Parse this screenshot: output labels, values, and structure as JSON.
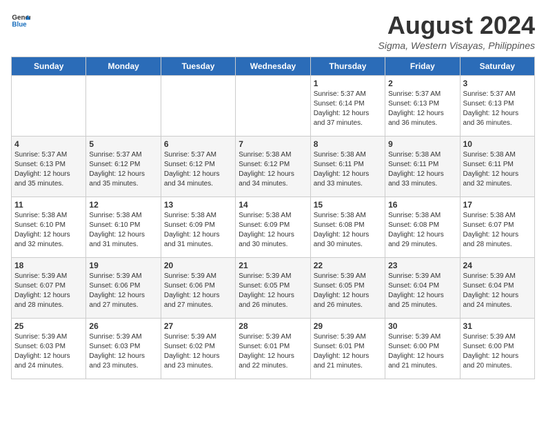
{
  "header": {
    "logo_general": "General",
    "logo_blue": "Blue",
    "month_year": "August 2024",
    "location": "Sigma, Western Visayas, Philippines"
  },
  "days_of_week": [
    "Sunday",
    "Monday",
    "Tuesday",
    "Wednesday",
    "Thursday",
    "Friday",
    "Saturday"
  ],
  "weeks": [
    [
      {
        "day": "",
        "empty": true
      },
      {
        "day": "",
        "empty": true
      },
      {
        "day": "",
        "empty": true
      },
      {
        "day": "",
        "empty": true
      },
      {
        "day": "1",
        "sunrise": "5:37 AM",
        "sunset": "6:14 PM",
        "daylight": "12 hours and 37 minutes."
      },
      {
        "day": "2",
        "sunrise": "5:37 AM",
        "sunset": "6:13 PM",
        "daylight": "12 hours and 36 minutes."
      },
      {
        "day": "3",
        "sunrise": "5:37 AM",
        "sunset": "6:13 PM",
        "daylight": "12 hours and 36 minutes."
      }
    ],
    [
      {
        "day": "4",
        "sunrise": "5:37 AM",
        "sunset": "6:13 PM",
        "daylight": "12 hours and 35 minutes."
      },
      {
        "day": "5",
        "sunrise": "5:37 AM",
        "sunset": "6:12 PM",
        "daylight": "12 hours and 35 minutes."
      },
      {
        "day": "6",
        "sunrise": "5:37 AM",
        "sunset": "6:12 PM",
        "daylight": "12 hours and 34 minutes."
      },
      {
        "day": "7",
        "sunrise": "5:38 AM",
        "sunset": "6:12 PM",
        "daylight": "12 hours and 34 minutes."
      },
      {
        "day": "8",
        "sunrise": "5:38 AM",
        "sunset": "6:11 PM",
        "daylight": "12 hours and 33 minutes."
      },
      {
        "day": "9",
        "sunrise": "5:38 AM",
        "sunset": "6:11 PM",
        "daylight": "12 hours and 33 minutes."
      },
      {
        "day": "10",
        "sunrise": "5:38 AM",
        "sunset": "6:11 PM",
        "daylight": "12 hours and 32 minutes."
      }
    ],
    [
      {
        "day": "11",
        "sunrise": "5:38 AM",
        "sunset": "6:10 PM",
        "daylight": "12 hours and 32 minutes."
      },
      {
        "day": "12",
        "sunrise": "5:38 AM",
        "sunset": "6:10 PM",
        "daylight": "12 hours and 31 minutes."
      },
      {
        "day": "13",
        "sunrise": "5:38 AM",
        "sunset": "6:09 PM",
        "daylight": "12 hours and 31 minutes."
      },
      {
        "day": "14",
        "sunrise": "5:38 AM",
        "sunset": "6:09 PM",
        "daylight": "12 hours and 30 minutes."
      },
      {
        "day": "15",
        "sunrise": "5:38 AM",
        "sunset": "6:08 PM",
        "daylight": "12 hours and 30 minutes."
      },
      {
        "day": "16",
        "sunrise": "5:38 AM",
        "sunset": "6:08 PM",
        "daylight": "12 hours and 29 minutes."
      },
      {
        "day": "17",
        "sunrise": "5:38 AM",
        "sunset": "6:07 PM",
        "daylight": "12 hours and 28 minutes."
      }
    ],
    [
      {
        "day": "18",
        "sunrise": "5:39 AM",
        "sunset": "6:07 PM",
        "daylight": "12 hours and 28 minutes."
      },
      {
        "day": "19",
        "sunrise": "5:39 AM",
        "sunset": "6:06 PM",
        "daylight": "12 hours and 27 minutes."
      },
      {
        "day": "20",
        "sunrise": "5:39 AM",
        "sunset": "6:06 PM",
        "daylight": "12 hours and 27 minutes."
      },
      {
        "day": "21",
        "sunrise": "5:39 AM",
        "sunset": "6:05 PM",
        "daylight": "12 hours and 26 minutes."
      },
      {
        "day": "22",
        "sunrise": "5:39 AM",
        "sunset": "6:05 PM",
        "daylight": "12 hours and 26 minutes."
      },
      {
        "day": "23",
        "sunrise": "5:39 AM",
        "sunset": "6:04 PM",
        "daylight": "12 hours and 25 minutes."
      },
      {
        "day": "24",
        "sunrise": "5:39 AM",
        "sunset": "6:04 PM",
        "daylight": "12 hours and 24 minutes."
      }
    ],
    [
      {
        "day": "25",
        "sunrise": "5:39 AM",
        "sunset": "6:03 PM",
        "daylight": "12 hours and 24 minutes."
      },
      {
        "day": "26",
        "sunrise": "5:39 AM",
        "sunset": "6:03 PM",
        "daylight": "12 hours and 23 minutes."
      },
      {
        "day": "27",
        "sunrise": "5:39 AM",
        "sunset": "6:02 PM",
        "daylight": "12 hours and 23 minutes."
      },
      {
        "day": "28",
        "sunrise": "5:39 AM",
        "sunset": "6:01 PM",
        "daylight": "12 hours and 22 minutes."
      },
      {
        "day": "29",
        "sunrise": "5:39 AM",
        "sunset": "6:01 PM",
        "daylight": "12 hours and 21 minutes."
      },
      {
        "day": "30",
        "sunrise": "5:39 AM",
        "sunset": "6:00 PM",
        "daylight": "12 hours and 21 minutes."
      },
      {
        "day": "31",
        "sunrise": "5:39 AM",
        "sunset": "6:00 PM",
        "daylight": "12 hours and 20 minutes."
      }
    ]
  ],
  "labels": {
    "sunrise": "Sunrise:",
    "sunset": "Sunset:",
    "daylight": "Daylight:"
  }
}
